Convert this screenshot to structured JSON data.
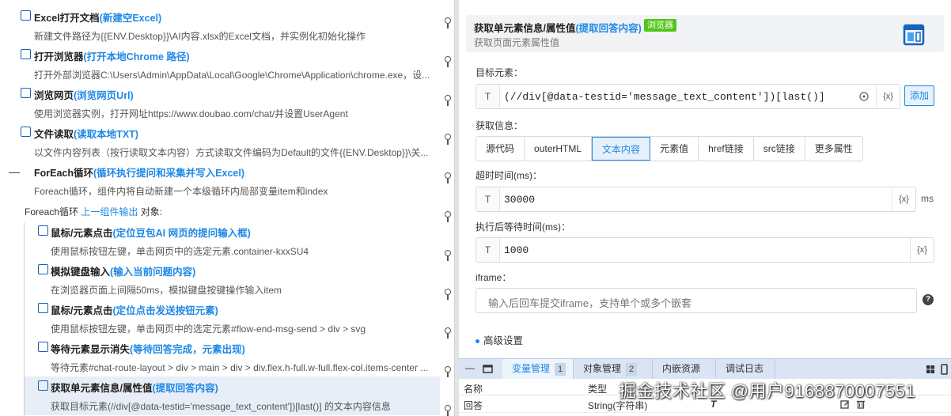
{
  "steps": [
    {
      "title": "Excel打开文档",
      "hl": "(新建空Excel)",
      "desc": "新建文件路径为{{ENV.Desktop}}\\AI内容.xlsx的Excel文档，并实例化初始化操作",
      "icon": "excel-icon"
    },
    {
      "title": "打开浏览器",
      "hl": "(打开本地Chrome 路径)",
      "desc": "打开外部浏览器C:\\Users\\Admin\\AppData\\Local\\Google\\Chrome\\Application\\chrome.exe，设...",
      "icon": "compass-icon"
    },
    {
      "title": "浏览网页",
      "hl": "(浏览网页Url)",
      "desc": "使用浏览器实例，打开网址https://www.doubao.com/chat/并设置UserAgent",
      "icon": "web-page-icon"
    },
    {
      "title": "文件读取",
      "hl": "(读取本地TXT)",
      "desc": "以文件内容列表（按行读取文本内容）方式读取文件编码为Default的文件{{ENV.Desktop}}\\关...",
      "icon": "file-icon"
    },
    {
      "title": "ForEach循环",
      "hl": "(循环执行提问和采集并写入Excel)",
      "desc": "Foreach循环，组件内将自动新建一个本级循环内局部变量item和index",
      "icon": "none"
    },
    {
      "title": "鼠标/元素点击",
      "hl": "(定位豆包AI 网页的提问输入框)",
      "desc": "使用鼠标按钮左键，单击网页中的选定元素.container-kxxSU4",
      "icon": "mouse-icon"
    },
    {
      "title": "模拟键盘输入",
      "hl": "(输入当前问题内容)",
      "desc": "在浏览器页面上间隔50ms，模拟键盘按键操作输入item",
      "icon": "keyboard-icon"
    },
    {
      "title": "鼠标/元素点击",
      "hl": "(定位点击发送按钮元素)",
      "desc": "使用鼠标按钮左键，单击网页中的选定元素#flow-end-msg-send > div > svg",
      "icon": "mouse-icon"
    },
    {
      "title": "等待元素显示消失",
      "hl": "(等待回答完成，元素出现)",
      "desc": "等待元素#chat-route-layout > div > main > div > div.flex.h-full.w-full.flex-col.items-center ...",
      "icon": "wait-icon"
    },
    {
      "title": "获取单元素信息/属性值",
      "hl": "(提取回答内容)",
      "desc": "获取目标元素(//div[@data-testid='message_text_content'])[last()] 的文本内容信息",
      "icon": "element-info-icon"
    }
  ],
  "foreach_obj": {
    "prefix": "Foreach循环 ",
    "link": "上一组件输出",
    "suffix": " 对象:"
  },
  "header": {
    "title": "获取单元素信息/属性值",
    "hl": "(提取回答内容)",
    "tag": "浏览器",
    "sub": "获取页面元素属性值"
  },
  "target": {
    "label": "目标元素：",
    "t": "T",
    "value": "(//div[@data-testid='message_text_content'])[last()]",
    "fx": "{x}",
    "add": "添加"
  },
  "info": {
    "label": "获取信息：",
    "tabs": [
      "源代码",
      "outerHTML",
      "文本内容",
      "元素值",
      "href链接",
      "src链接",
      "更多属性"
    ],
    "active": "文本内容"
  },
  "timeout": {
    "label": "超时时间(ms)：",
    "t": "T",
    "value": "30000",
    "fx": "{x}",
    "unit": "ms"
  },
  "wait": {
    "label": "执行后等待时间(ms)：",
    "t": "T",
    "value": "1000",
    "fx": "{x}"
  },
  "iframe": {
    "label": "iframe：",
    "placeholder": "输入后回车提交iframe，支持单个或多个嵌套",
    "help": "?"
  },
  "advanced": "高级设置",
  "bottom": {
    "tabs": [
      {
        "label": "变量管理",
        "count": "1"
      },
      {
        "label": "对象管理",
        "count": "2"
      },
      {
        "label": "内嵌资源",
        "count": ""
      },
      {
        "label": "调试日志",
        "count": ""
      }
    ],
    "active": "变量管理",
    "headers": [
      "名称",
      "类型"
    ],
    "row": {
      "name": "回答",
      "type": "String(字符串)",
      "t": "T"
    }
  },
  "watermark": "掘金技术社区 @用户9168870007551"
}
